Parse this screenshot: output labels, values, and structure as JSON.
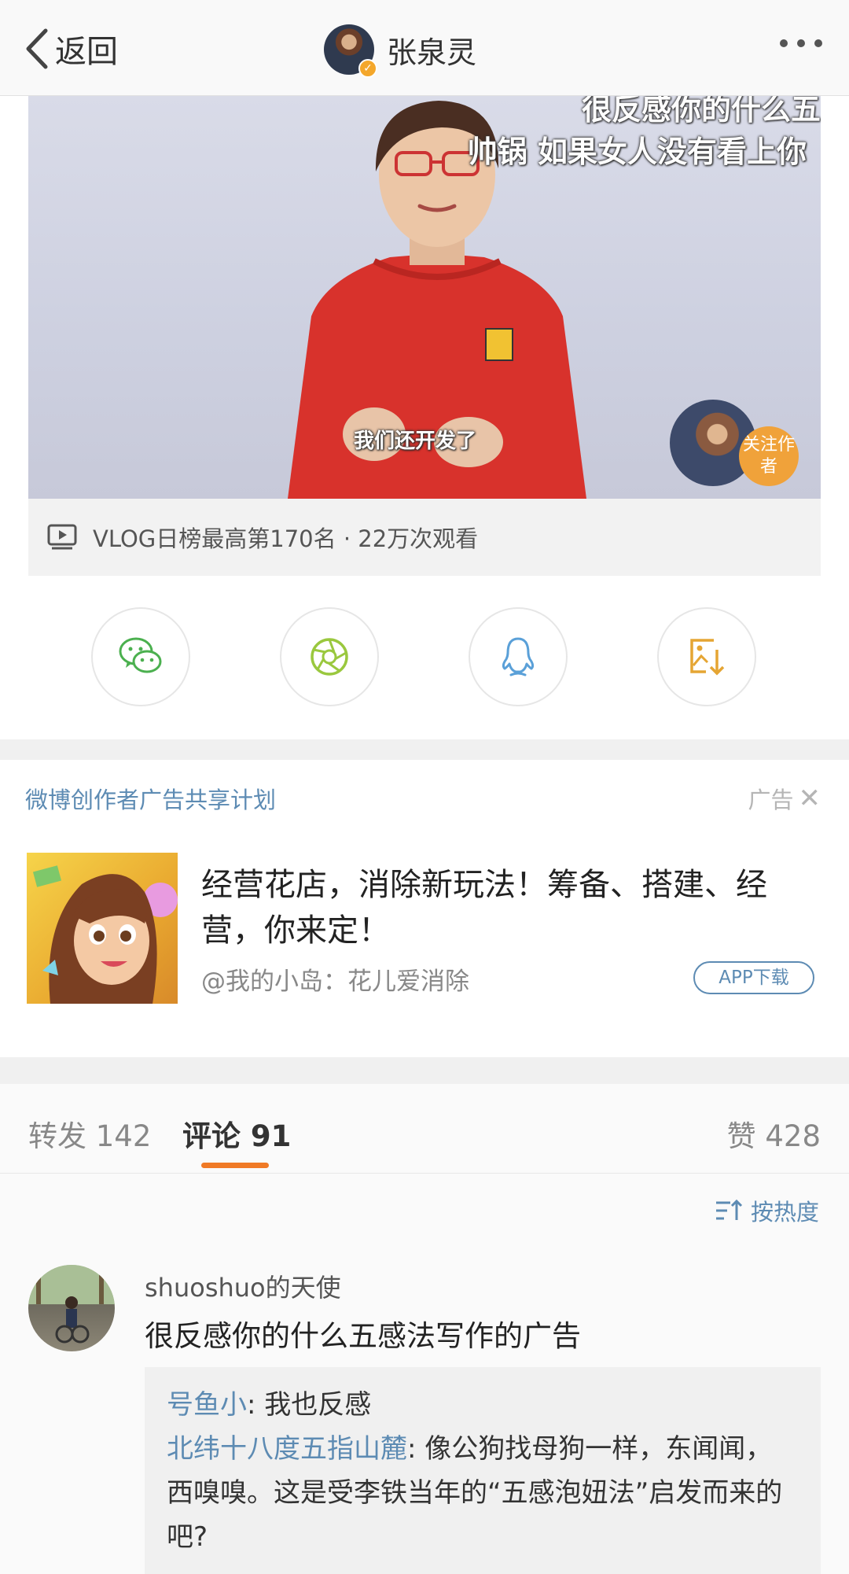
{
  "nav": {
    "back_label": "返回",
    "user_name": "张泉灵"
  },
  "video": {
    "subtitle_top_partial": "很反感你的什么五",
    "subtitle_top": "帅锅 如果女人没有看上你",
    "subtitle_bottom": "我们还开发了",
    "follow_badge": "关注作者",
    "info": "VLOG日榜最高第170名 · 22万次观看"
  },
  "share": [
    "wechat-icon",
    "moments-icon",
    "qq-icon",
    "save-image-icon"
  ],
  "ad": {
    "plan_title": "微博创作者广告共享计划",
    "ad_label": "广告",
    "headline": "经营花店，消除新玩法！筹备、搭建、经营，你来定！",
    "source": "@我的小岛：花儿爱消除",
    "download_label": "APP下载"
  },
  "tabs": {
    "forward": "转发 142",
    "comments": "评论 91",
    "likes": "赞 428"
  },
  "comments": {
    "sort_label": "按热度",
    "items": [
      {
        "user": "shuoshuo的天使",
        "text": "很反感你的什么五感法写作的广告",
        "replies": [
          {
            "user": "号鱼小",
            "text": ": 我也反感"
          },
          {
            "user": "北纬十八度五指山麓",
            "text": ": 像公狗找母狗一样，东闻闻，西嗅嗅。这是受李铁当年的“五感泡妞法”启发而来的吧?"
          }
        ]
      }
    ]
  },
  "colors": {
    "accent_blue": "#5d8bb3",
    "tab_underline": "#f07a26",
    "follow_badge": "#f0a23a",
    "wechat_green": "#4bb04f",
    "moments_green": "#9ac83e",
    "qq_blue": "#5aa0d8",
    "save_orange": "#e5a533"
  }
}
